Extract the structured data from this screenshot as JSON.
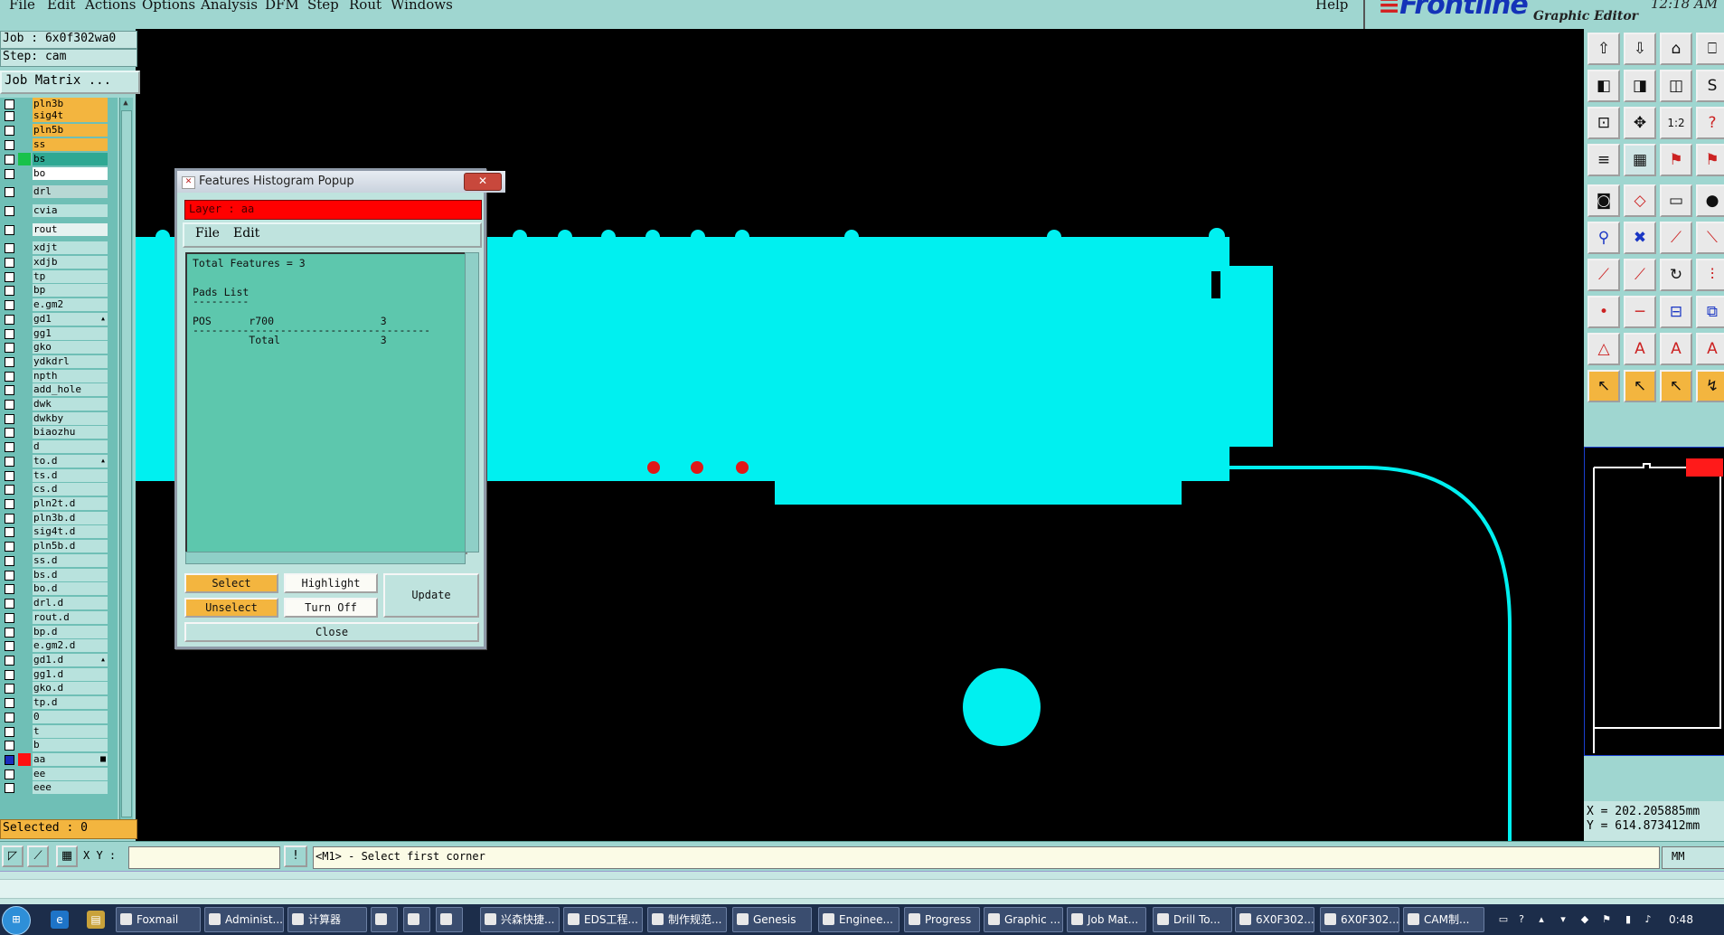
{
  "menubar": {
    "items": [
      "File",
      "Edit",
      "Actions",
      "Options",
      "Analysis",
      "DFM",
      "Step",
      "Rout",
      "Windows"
    ],
    "help": "Help"
  },
  "brand": {
    "logo": "Frontline",
    "subtitle": "Graphic Editor",
    "clock": "12:18 AM"
  },
  "left": {
    "job": "Job : 6x0f302wa0",
    "step": "Step: cam",
    "job_matrix": "Job Matrix ...",
    "layers": [
      {
        "name": "pln3b",
        "color": "#f3b53f",
        "swatch": ""
      },
      {
        "name": "sig4t",
        "color": "#f3b53f",
        "swatch": ""
      },
      {
        "name": "pln5b",
        "color": "#f3b53f",
        "swatch": ""
      },
      {
        "name": "ss",
        "color": "#f3b53f",
        "swatch": ""
      },
      {
        "name": "bs",
        "color": "#2fa893",
        "swatch": "#18c24a"
      },
      {
        "name": "bo",
        "color": "#ffffff",
        "swatch": ""
      },
      {
        "name": "drl",
        "color": "#b8d8d4",
        "swatch": ""
      },
      {
        "name": "cvia",
        "color": "#b8e2dd",
        "swatch": ""
      },
      {
        "name": "rout",
        "color": "#e6f2f0",
        "swatch": ""
      },
      {
        "name": "xdjt",
        "color": "#b8e2dd",
        "swatch": ""
      },
      {
        "name": "xdjb",
        "color": "#b8e2dd",
        "swatch": ""
      },
      {
        "name": "tp",
        "color": "#b8e2dd",
        "swatch": ""
      },
      {
        "name": "bp",
        "color": "#b8e2dd",
        "swatch": ""
      },
      {
        "name": "e.gm2",
        "color": "#b8e2dd",
        "swatch": ""
      },
      {
        "name": "gd1",
        "color": "#b8e2dd",
        "swatch": "",
        "mark": "▴"
      },
      {
        "name": "gg1",
        "color": "#b8e2dd",
        "swatch": ""
      },
      {
        "name": "gko",
        "color": "#b8e2dd",
        "swatch": ""
      },
      {
        "name": "ydkdrl",
        "color": "#b8e2dd",
        "swatch": ""
      },
      {
        "name": "npth",
        "color": "#b8e2dd",
        "swatch": ""
      },
      {
        "name": "add_hole",
        "color": "#b8e2dd",
        "swatch": ""
      },
      {
        "name": "dwk",
        "color": "#b8e2dd",
        "swatch": ""
      },
      {
        "name": "dwkby",
        "color": "#b8e2dd",
        "swatch": ""
      },
      {
        "name": "biaozhu",
        "color": "#b8e2dd",
        "swatch": ""
      },
      {
        "name": "d",
        "color": "#b8e2dd",
        "swatch": ""
      },
      {
        "name": "to.d",
        "color": "#b8e2dd",
        "swatch": "",
        "mark": "▴"
      },
      {
        "name": "ts.d",
        "color": "#b8e2dd",
        "swatch": ""
      },
      {
        "name": "cs.d",
        "color": "#b8e2dd",
        "swatch": ""
      },
      {
        "name": "pln2t.d",
        "color": "#b8e2dd",
        "swatch": ""
      },
      {
        "name": "pln3b.d",
        "color": "#b8e2dd",
        "swatch": ""
      },
      {
        "name": "sig4t.d",
        "color": "#b8e2dd",
        "swatch": ""
      },
      {
        "name": "pln5b.d",
        "color": "#b8e2dd",
        "swatch": ""
      },
      {
        "name": "ss.d",
        "color": "#b8e2dd",
        "swatch": ""
      },
      {
        "name": "bs.d",
        "color": "#b8e2dd",
        "swatch": ""
      },
      {
        "name": "bo.d",
        "color": "#b8e2dd",
        "swatch": ""
      },
      {
        "name": "drl.d",
        "color": "#b8e2dd",
        "swatch": ""
      },
      {
        "name": "rout.d",
        "color": "#b8e2dd",
        "swatch": ""
      },
      {
        "name": "bp.d",
        "color": "#b8e2dd",
        "swatch": ""
      },
      {
        "name": "e.gm2.d",
        "color": "#b8e2dd",
        "swatch": ""
      },
      {
        "name": "gd1.d",
        "color": "#b8e2dd",
        "swatch": "",
        "mark": "▴"
      },
      {
        "name": "gg1.d",
        "color": "#b8e2dd",
        "swatch": ""
      },
      {
        "name": "gko.d",
        "color": "#b8e2dd",
        "swatch": ""
      },
      {
        "name": "tp.d",
        "color": "#b8e2dd",
        "swatch": ""
      },
      {
        "name": "0",
        "color": "#b8e2dd",
        "swatch": ""
      },
      {
        "name": "t",
        "color": "#b8e2dd",
        "swatch": ""
      },
      {
        "name": "b",
        "color": "#b8e2dd",
        "swatch": ""
      },
      {
        "name": "aa",
        "color": "#b8e2dd",
        "swatch": "#ff1010",
        "mark": "■",
        "active": true
      },
      {
        "name": "ee",
        "color": "#b8e2dd",
        "swatch": ""
      },
      {
        "name": "eee",
        "color": "#b8e2dd",
        "swatch": ""
      }
    ],
    "selected": "Selected : 0"
  },
  "popup": {
    "title": "Features Histogram Popup",
    "close_glyph": "✕",
    "layer": "Layer :  aa",
    "menu": [
      "File",
      "Edit"
    ],
    "report": [
      "Total Features = 3",
      "",
      "Pads List",
      "---------",
      "",
      "POS      r700                 3",
      "--------------------------------------",
      "         Total                3"
    ],
    "buttons": {
      "select": "Select",
      "highlight": "Highlight",
      "unselect": "Unselect",
      "turn_off": "Turn Off",
      "update": "Update",
      "close": "Close"
    }
  },
  "right": {
    "coords_x": "X = 202.205885mm",
    "coords_y": "Y = 614.873412mm",
    "tools": [
      "⇧",
      "⇩",
      "⌂",
      "⎕",
      "◧",
      "◨",
      "◫",
      "S",
      "⊡",
      "✥",
      "1:2",
      "?",
      "≡",
      "▦",
      "⚑",
      "⚑",
      "◙",
      "◇",
      "▭",
      "●",
      "⚲",
      "✖",
      "⟋",
      "⟍",
      "⟋",
      "⟋",
      "↻",
      "⫶",
      "•",
      "─",
      "⊟",
      "⧉",
      "△",
      "A",
      "A",
      "A",
      "↖",
      "↖",
      "↖",
      "↯"
    ]
  },
  "cmdbar": {
    "xy_label": "X Y :",
    "xy_value": "",
    "info_icon": "!",
    "prompt": "<M1> - Select first corner",
    "units": "MM"
  },
  "taskbar": {
    "tasks": [
      "Foxmail",
      "Administ...",
      "计算器",
      "",
      "",
      "",
      "兴森快捷...",
      "EDS工程...",
      "制作规范...",
      "Genesis",
      "Enginee...",
      "Progress",
      "Graphic ...",
      "Job Mat...",
      "Drill To...",
      "6X0F302...",
      "6X0F302...",
      "CAM制..."
    ],
    "time": "0:48"
  },
  "colors": {
    "board": "#00f0f0",
    "pad": "#e01818",
    "panel": "#9fd6d0",
    "highlight": "#f3b53f"
  }
}
